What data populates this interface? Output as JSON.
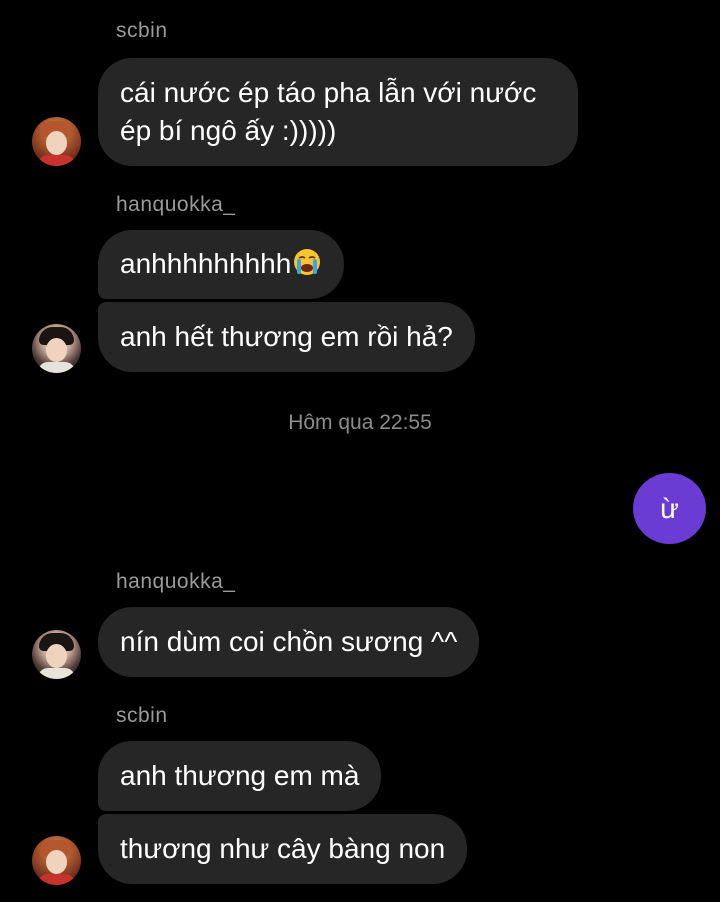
{
  "messages": [
    {
      "sender": "scbin",
      "bubbles": [
        "cái nước ép táo pha lẫn với nước ép bí ngô ấy :)))))"
      ]
    },
    {
      "sender": "hanquokka_",
      "bubbles": [
        "anhhhhhhhhh",
        "anh hết thương em rồi hả?"
      ],
      "emoji_after_first": "loudly-crying-face-icon"
    },
    {
      "sender": "hanquokka_",
      "bubbles": [
        "nín dùm coi chồn sương ^^"
      ]
    },
    {
      "sender": "scbin",
      "bubbles": [
        "anh thương em mà",
        "thương như cây bàng non"
      ]
    }
  ],
  "timestamp": "Hôm qua 22:55",
  "my_message": "ừ",
  "colors": {
    "background": "#000000",
    "bubble_received": "#262626",
    "bubble_sent": "#6a3cd4",
    "sender_text": "#9a9a9a"
  }
}
